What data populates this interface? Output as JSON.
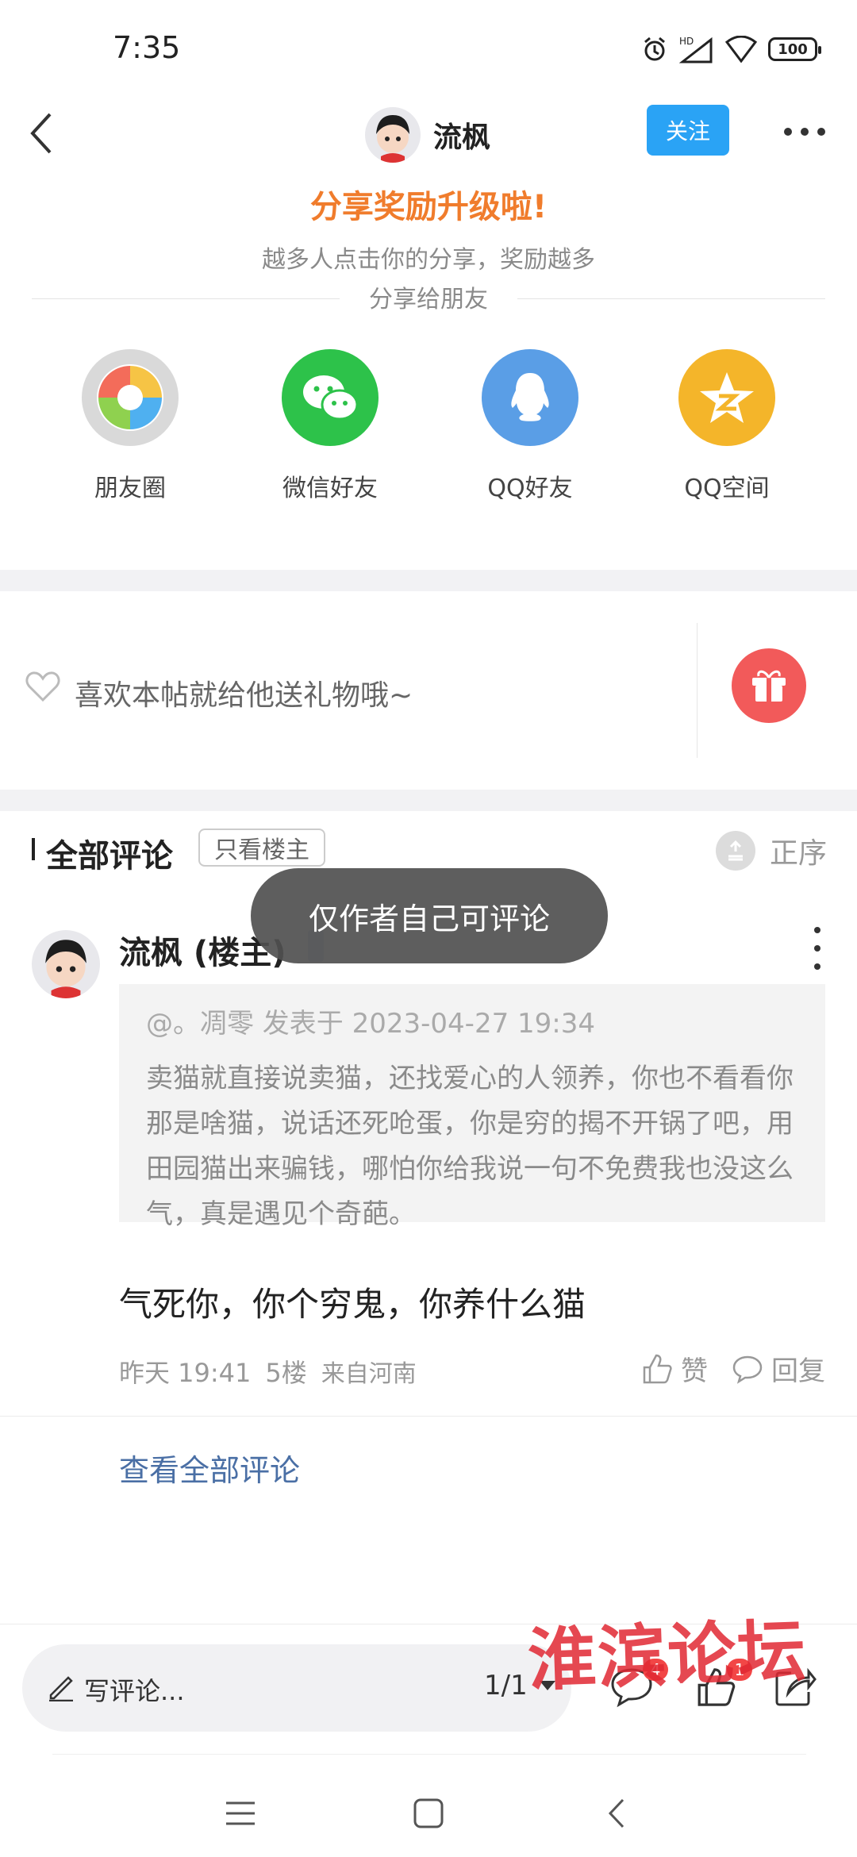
{
  "status_bar": {
    "time": "7:35",
    "battery": "100"
  },
  "header": {
    "author_name": "流枫",
    "follow_label": "关注"
  },
  "share": {
    "title": "分享奖励升级啦!",
    "subtitle": "越多人点击你的分享，奖励越多",
    "share_to": "分享给朋友",
    "items": [
      {
        "label": "朋友圈",
        "icon": "moments-icon",
        "color": "#d9d9d9"
      },
      {
        "label": "微信好友",
        "icon": "wechat-icon",
        "color": "#2dc24a"
      },
      {
        "label": "QQ好友",
        "icon": "qq-icon",
        "color": "#5a9ee6"
      },
      {
        "label": "QQ空间",
        "icon": "qzone-icon",
        "color": "#f4b52a"
      }
    ]
  },
  "gift": {
    "hint": "喜欢本帖就给他送礼物哦~"
  },
  "comments": {
    "title": "全部评论",
    "only_host": "只看楼主",
    "sort": "正序",
    "toast": "仅作者自己可评论",
    "item": {
      "name": "流枫 (楼主)",
      "quote_meta": "@。凋零 发表于 2023-04-27 19:34",
      "quote_text": "卖猫就直接说卖猫，还找爱心的人领养，你也不看看你那是啥猫，说话还死呛蛋，你是穷的揭不开锅了吧，用田园猫出来骗钱，哪怕你给我说一句不免费我也没这么气，真是遇见个奇葩。",
      "body": "气死你，你个穷鬼，你养什么猫",
      "time": "昨天 19:41",
      "floor": "5楼",
      "location": "来自河南",
      "like_label": "赞",
      "reply_label": "回复"
    },
    "view_all": "查看全部评论"
  },
  "bottom_bar": {
    "placeholder": "写评论...",
    "page": "1/1",
    "comment_count": "4",
    "like_count": "1",
    "watermark": "淮滨论坛"
  }
}
